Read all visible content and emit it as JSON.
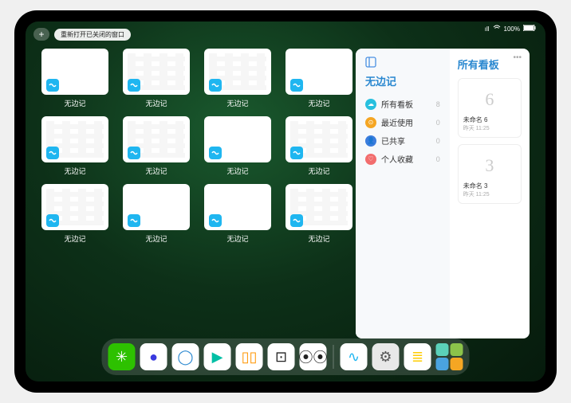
{
  "status": {
    "signal": "•••",
    "battery": "100%"
  },
  "topbar": {
    "plus": "+",
    "reopen_label": "重新打开已关闭的窗口"
  },
  "windows": [
    {
      "label": "无边记",
      "variant": "blank"
    },
    {
      "label": "无边记",
      "variant": "cal"
    },
    {
      "label": "无边记",
      "variant": "cal"
    },
    {
      "label": "无边记",
      "variant": "blank"
    },
    {
      "label": "无边记",
      "variant": "cal"
    },
    {
      "label": "无边记",
      "variant": "cal"
    },
    {
      "label": "无边记",
      "variant": "blank"
    },
    {
      "label": "无边记",
      "variant": "cal"
    },
    {
      "label": "无边记",
      "variant": "cal"
    },
    {
      "label": "无边记",
      "variant": "blank"
    },
    {
      "label": "无边记",
      "variant": "blank"
    },
    {
      "label": "无边记",
      "variant": "cal"
    }
  ],
  "panel": {
    "left_title": "无边记",
    "right_title": "所有看板",
    "items": [
      {
        "icon_color": "#28c0de",
        "glyph": "☁︎",
        "label": "所有看板",
        "count": "8"
      },
      {
        "icon_color": "#f5a623",
        "glyph": "⊙",
        "label": "最近使用",
        "count": "0"
      },
      {
        "icon_color": "#3b7ddd",
        "glyph": "👤",
        "label": "已共享",
        "count": "0"
      },
      {
        "icon_color": "#f26d6d",
        "glyph": "♡",
        "label": "个人收藏",
        "count": "0"
      }
    ],
    "boards": [
      {
        "glyph": "6",
        "name": "未命名 6",
        "date": "昨天 11:25"
      },
      {
        "glyph": "3",
        "name": "未命名 3",
        "date": "昨天 11:25"
      }
    ]
  },
  "dock": {
    "apps": [
      {
        "name": "wechat",
        "bg": "#2dc100",
        "glyph": "✳︎"
      },
      {
        "name": "quark",
        "bg": "#ffffff",
        "glyph": "●",
        "color": "#3a3adf"
      },
      {
        "name": "browser",
        "bg": "#ffffff",
        "glyph": "◯",
        "color": "#2a88d0"
      },
      {
        "name": "youku",
        "bg": "#ffffff",
        "glyph": "▶",
        "color": "#00bfa5"
      },
      {
        "name": "books",
        "bg": "#ffffff",
        "glyph": "▯▯",
        "color": "#ff9500"
      },
      {
        "name": "dice",
        "bg": "#ffffff",
        "glyph": "⊡",
        "color": "#222"
      },
      {
        "name": "nodes",
        "bg": "#ffffff",
        "glyph": "⦿⦿",
        "color": "#222"
      }
    ],
    "recent": [
      {
        "name": "freeform",
        "bg": "#ffffff",
        "glyph": "∿",
        "color": "#1fb6f0"
      },
      {
        "name": "settings",
        "bg": "#e8e8e8",
        "glyph": "⚙",
        "color": "#555"
      },
      {
        "name": "notes",
        "bg": "#ffffff",
        "glyph": "≣",
        "color": "#ffcc00"
      }
    ]
  }
}
